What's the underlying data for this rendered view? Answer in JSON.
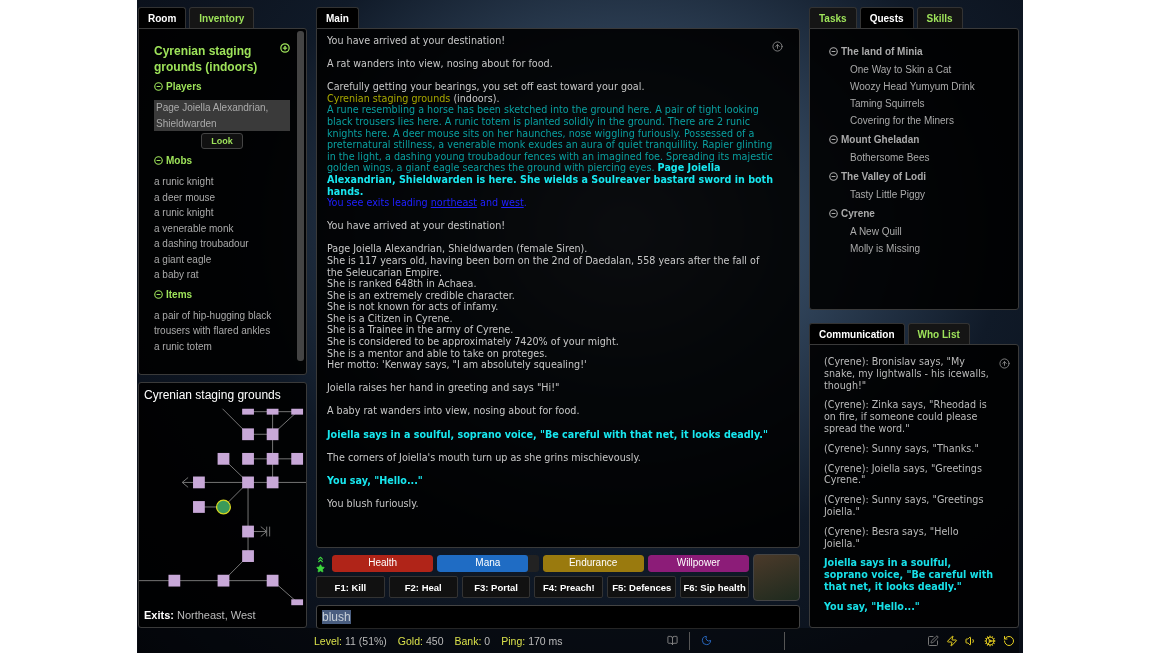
{
  "left_tabs": [
    {
      "label": "Room",
      "selected": true
    },
    {
      "label": "Inventory",
      "selected": false
    }
  ],
  "room": {
    "title": "Cyrenian staging grounds (indoors)",
    "sections": [
      {
        "kind": "players",
        "title": "Players",
        "expanded": true,
        "items": [
          "Page Joiella Alexandrian, Shieldwarden"
        ],
        "button": "Look"
      },
      {
        "kind": "list",
        "title": "Mobs",
        "expanded": true,
        "items": [
          "a runic knight",
          "a deer mouse",
          "a runic knight",
          "a venerable monk",
          "a dashing troubadour",
          "a giant eagle",
          "a baby rat"
        ]
      },
      {
        "kind": "list",
        "title": "Items",
        "expanded": true,
        "items": [
          "a pair of hip-hugging black trousers with flared ankles",
          "a runic totem"
        ]
      }
    ]
  },
  "map": {
    "title": "Cyrenian staging grounds",
    "exits_label": "Exits:",
    "exits": "Northeast, West"
  },
  "main_tabs": [
    {
      "label": "Main",
      "selected": true
    }
  ],
  "output": [
    [
      [
        {
          "kind": "plain",
          "text": "You have arrived at your destination!"
        }
      ]
    ],
    [
      [
        {
          "kind": "plain",
          "text": "A rat wanders into view, nosing about for food."
        }
      ]
    ],
    [
      [
        {
          "kind": "plain",
          "text": "Carefully getting your bearings, you set off east toward your goal."
        }
      ],
      [
        {
          "kind": "room",
          "text": "Cyrenian staging grounds"
        },
        {
          "kind": "plain",
          "text": " (indoors)."
        }
      ],
      [
        {
          "kind": "desc",
          "text": "A rune resembling a horse has been sketched into the ground here. A pair of tight looking black trousers lies here. A runic totem is planted solidly in the ground. There are 2 runic knights here. A deer mouse sits on her haunches, nose wiggling furiously. Possessed of a preternatural stillness, a venerable monk exudes an aura of quiet tranquillity. Rapier glinting in the light, a dashing young troubadour fences with an imagined foe. Spreading its majestic golden wings, a giant eagle searches the ground with piercing eyes.  "
        },
        {
          "kind": "player",
          "text": "Page Joiella Alexandrian, Shieldwarden is here. She wields a Soulreaver bastard sword in both hands."
        }
      ],
      [
        {
          "kind": "exits",
          "text": "You see exits leading "
        },
        {
          "kind": "link",
          "text": "northeast"
        },
        {
          "kind": "exits",
          "text": " and "
        },
        {
          "kind": "link",
          "text": "west"
        },
        {
          "kind": "exits",
          "text": "."
        }
      ]
    ],
    [
      [
        {
          "kind": "plain",
          "text": "You have arrived at your destination!"
        }
      ]
    ],
    [
      [
        {
          "kind": "plain",
          "text": "Page Joiella Alexandrian, Shieldwarden (female Siren)."
        }
      ],
      [
        {
          "kind": "plain",
          "text": "She is 117 years old, having been born on the 2nd of Daedalan, 558 years after the fall of the Seleucarian Empire."
        }
      ],
      [
        {
          "kind": "plain",
          "text": "She is ranked 648th in Achaea."
        }
      ],
      [
        {
          "kind": "plain",
          "text": "She is an extremely credible character."
        }
      ],
      [
        {
          "kind": "plain",
          "text": "She is not known for acts of infamy."
        }
      ],
      [
        {
          "kind": "plain",
          "text": "She is a Citizen in Cyrene."
        }
      ],
      [
        {
          "kind": "plain",
          "text": "She is a Trainee in the army of Cyrene."
        }
      ],
      [
        {
          "kind": "plain",
          "text": "She is considered to be approximately 7420% of your might."
        }
      ],
      [
        {
          "kind": "plain",
          "text": "She is a mentor and able to take on proteges."
        }
      ],
      [
        {
          "kind": "plain",
          "text": "Her motto: 'Kenway says, \"I am absolutely squealing!'"
        }
      ]
    ],
    [
      [
        {
          "kind": "plain",
          "text": "Joiella raises her hand in greeting and says \"Hi!\""
        }
      ]
    ],
    [
      [
        {
          "kind": "plain",
          "text": "A baby rat wanders into view, nosing about for food."
        }
      ]
    ],
    [
      [
        {
          "kind": "say",
          "text": "Joiella says in a soulful, soprano voice, \"Be careful with that net, it looks deadly.\""
        }
      ]
    ],
    [
      [
        {
          "kind": "plain",
          "text": "The corners of Joiella's mouth turn up as she grins mischievously."
        }
      ]
    ],
    [
      [
        {
          "kind": "say",
          "text": "You say, \"Hello...\""
        }
      ]
    ],
    [
      [
        {
          "kind": "plain",
          "text": "You blush furiously."
        }
      ]
    ]
  ],
  "vitals": [
    {
      "label": "Health",
      "level": 1,
      "color": "#b02418"
    },
    {
      "label": "Mana",
      "level": 0.9,
      "color": "#1f6cc4"
    },
    {
      "label": "Endurance",
      "level": 1,
      "color": "#9a7a0e"
    },
    {
      "label": "Willpower",
      "level": 1,
      "color": "#8c1c78"
    }
  ],
  "hotkeys": [
    "F1: Kill",
    "F2: Heal",
    "F3: Portal",
    "F4: Preach!",
    "F5: Defences",
    "F6: Sip health"
  ],
  "command": {
    "value": "blush"
  },
  "status": [
    {
      "label": "Level:",
      "value": "11 (51%)"
    },
    {
      "label": "Gold:",
      "value": "450"
    },
    {
      "label": "Bank:",
      "value": "0"
    },
    {
      "label": "Ping:",
      "value": "170 ms"
    }
  ],
  "right_tabs": [
    {
      "label": "Tasks",
      "selected": false
    },
    {
      "label": "Quests",
      "selected": true
    },
    {
      "label": "Skills",
      "selected": false
    }
  ],
  "quests": [
    {
      "title": "The land of Minia",
      "expanded": true,
      "children": [
        "One Way to Skin a Cat",
        "Woozy Head Yumyum Drink",
        "Taming Squirrels",
        "Covering for the Miners"
      ]
    },
    {
      "title": "Mount Gheladan",
      "expanded": true,
      "children": [
        "Bothersome Bees"
      ]
    },
    {
      "title": "The Valley of Lodi",
      "expanded": true,
      "children": [
        "Tasty Little Piggy"
      ]
    },
    {
      "title": "Cyrene",
      "expanded": true,
      "children": [
        "A New Quill",
        "Molly is Missing"
      ]
    }
  ],
  "comm_tabs": [
    {
      "label": "Communication",
      "selected": true
    },
    {
      "label": "Who List",
      "selected": false
    }
  ],
  "messages": [
    {
      "kind": "channel",
      "text": "(Cyrene): Bronislav says, \"My snake, my lightwalls - his icewalls, though!\""
    },
    {
      "kind": "channel",
      "text": "(Cyrene): Zinka says, \"Rheodad is on fire, if someone could please spread the word.\""
    },
    {
      "kind": "channel",
      "text": "(Cyrene): Sunny says, \"Thanks.\""
    },
    {
      "kind": "channel",
      "text": "(Cyrene): Joiella says, \"Greetings Cyrene.\""
    },
    {
      "kind": "channel",
      "text": "(Cyrene): Sunny says, \"Greetings Joiella.\""
    },
    {
      "kind": "channel",
      "text": "(Cyrene): Besra says, \"Hello Joiella.\""
    },
    {
      "kind": "say",
      "text": "Joiella says in a soulful, soprano voice, \"Be careful with that net, it looks deadly.\""
    },
    {
      "kind": "say",
      "text": "You say, \"Hello...\""
    }
  ]
}
